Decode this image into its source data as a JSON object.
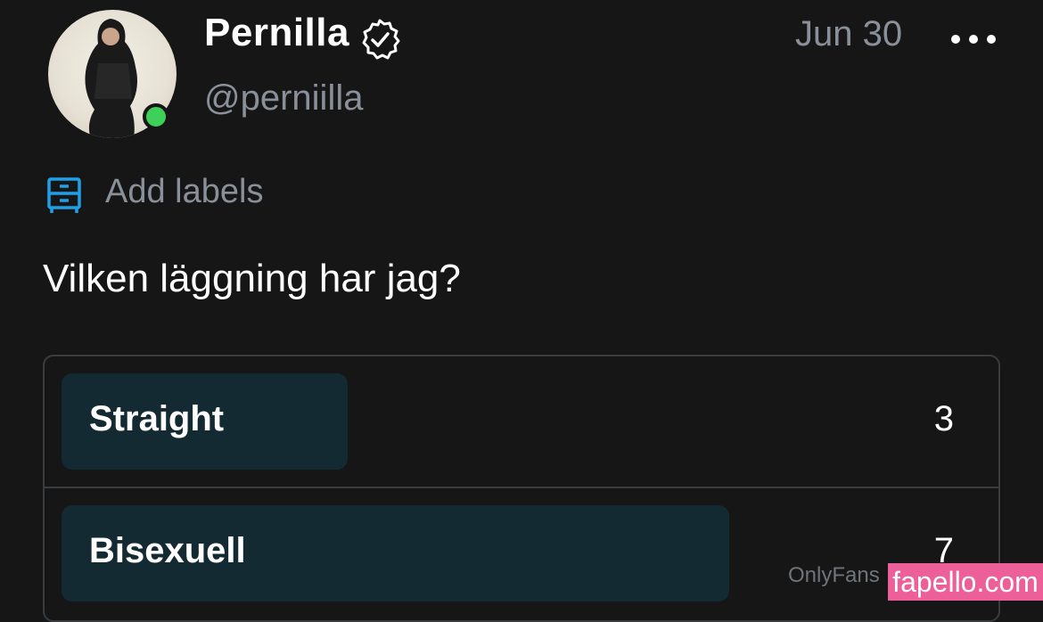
{
  "post": {
    "author_name": "Pernilla",
    "handle": "@perniilla",
    "date": "Jun 30",
    "add_labels": "Add labels",
    "text": "Vilken läggning har jag?"
  },
  "poll": {
    "max_votes": 10,
    "options": [
      {
        "label": "Straight",
        "votes": "3",
        "fill": 0.3
      },
      {
        "label": "Bisexuell",
        "votes": "7",
        "fill": 0.7
      }
    ]
  },
  "watermarks": {
    "onlyfans": "OnlyFans",
    "fapello": "fapello.com"
  },
  "icons": {
    "verified": "verified-badge-icon",
    "more": "more-dots-icon",
    "labels": "drawer-icon"
  },
  "colors": {
    "background": "#161616",
    "online": "#3ed15a",
    "muted_text": "#8a9099",
    "accent_blue": "#1da1e8",
    "poll_bar": "#132a33",
    "watermark": "#ec5f99"
  }
}
